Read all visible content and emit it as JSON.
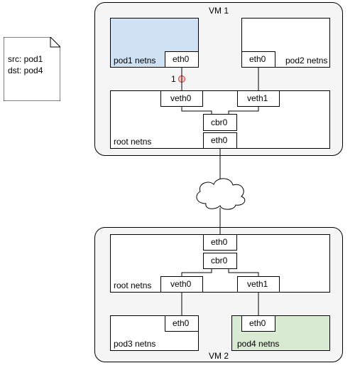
{
  "note": {
    "src": "src: pod1",
    "dst": "dst: pod4"
  },
  "vm1": {
    "title": "VM 1",
    "root_netns": "root netns",
    "pod1_netns": "pod1 netns",
    "pod2_netns": "pod2 netns",
    "eth0": "eth0",
    "veth0": "veth0",
    "veth1": "veth1",
    "cbr0": "cbr0",
    "marker1": "1"
  },
  "vm2": {
    "title": "VM 2",
    "root_netns": "root netns",
    "pod3_netns": "pod3 netns",
    "pod4_netns": "pod4 netns",
    "eth0": "eth0",
    "veth0": "veth0",
    "veth1": "veth1",
    "cbr0": "cbr0"
  },
  "colors": {
    "pod_src": "#cfe2f3",
    "pod_dst": "#d9ead3",
    "vm_bg": "#f5f5f5",
    "note_bg": "#ffffff"
  }
}
